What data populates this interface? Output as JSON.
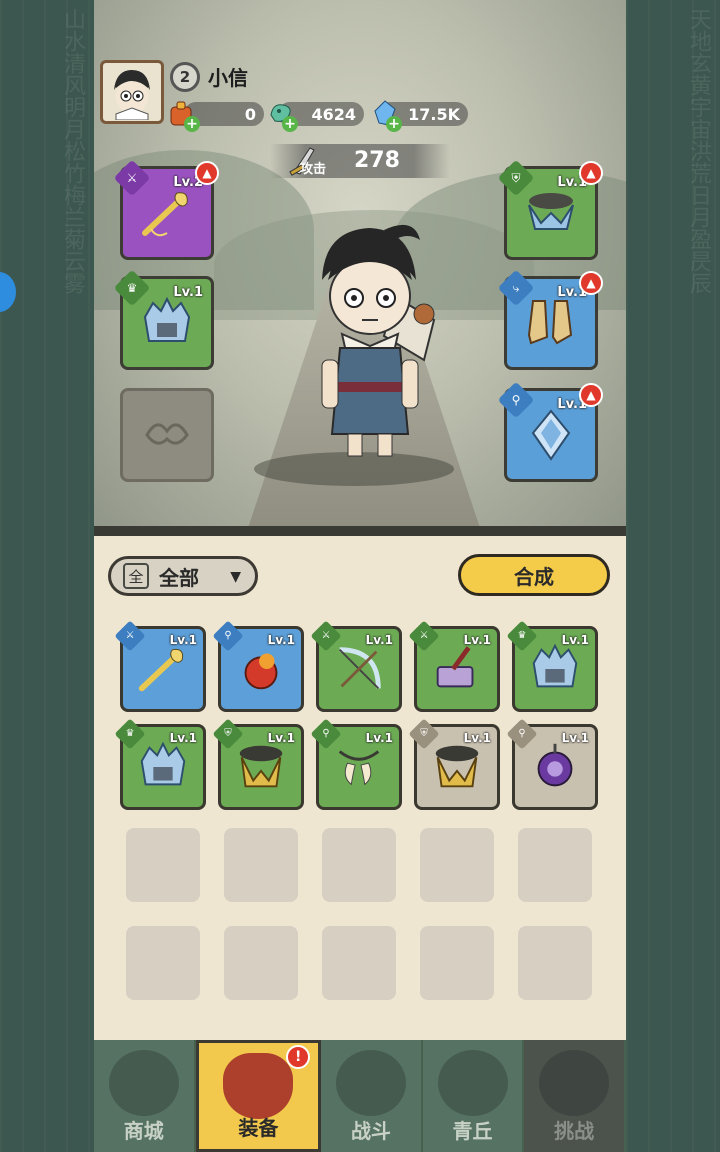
{
  "player": {
    "name": "小信",
    "level": "2"
  },
  "currencies": [
    {
      "icon": "gift-bag-icon",
      "value": "0"
    },
    {
      "icon": "jade-dragon-icon",
      "value": "4624"
    },
    {
      "icon": "crystal-icon",
      "value": "17.5K"
    }
  ],
  "attack": {
    "label": "攻击",
    "value": "278"
  },
  "equipped": {
    "left": [
      {
        "name": "weapon",
        "level": "Lv.2",
        "rarity": "purple",
        "icon": "golden-staff-icon",
        "upgrade": true
      },
      {
        "name": "helmet",
        "level": "Lv.1",
        "rarity": "green",
        "icon": "ice-helmet-icon",
        "upgrade": false
      },
      {
        "name": "accessory",
        "level": "",
        "rarity": "empty",
        "icon": "empty-ornament-icon",
        "upgrade": false
      }
    ],
    "right": [
      {
        "name": "armor",
        "level": "Lv.1",
        "rarity": "green",
        "icon": "fur-armor-icon",
        "upgrade": true
      },
      {
        "name": "boots",
        "level": "Lv.1",
        "rarity": "blue",
        "icon": "boots-icon",
        "upgrade": true
      },
      {
        "name": "amulet",
        "level": "Lv.1",
        "rarity": "blue",
        "icon": "crystal-amulet-icon",
        "upgrade": true
      }
    ]
  },
  "filter": {
    "box_label": "全",
    "label": "全部"
  },
  "merge_label": "合成",
  "inventory": [
    {
      "rarity": "blue",
      "level": "Lv.1",
      "icon": "golden-staff-icon"
    },
    {
      "rarity": "blue",
      "level": "Lv.1",
      "icon": "red-orb-necklace-icon"
    },
    {
      "rarity": "green",
      "level": "Lv.1",
      "icon": "bow-icon"
    },
    {
      "rarity": "green",
      "level": "Lv.1",
      "icon": "hammer-icon"
    },
    {
      "rarity": "green",
      "level": "Lv.1",
      "icon": "ice-helmet-icon"
    },
    {
      "rarity": "green",
      "level": "Lv.1",
      "icon": "ice-helmet-icon"
    },
    {
      "rarity": "green",
      "level": "Lv.1",
      "icon": "gold-armor-icon"
    },
    {
      "rarity": "green",
      "level": "Lv.1",
      "icon": "fang-necklace-icon"
    },
    {
      "rarity": "grey",
      "level": "Lv.1",
      "icon": "gold-armor-icon"
    },
    {
      "rarity": "grey",
      "level": "Lv.1",
      "icon": "purple-orb-icon"
    }
  ],
  "nav": [
    {
      "label": "商城",
      "icon": "shop-icon",
      "state": "normal"
    },
    {
      "label": "装备",
      "icon": "equipment-helmet-icon",
      "state": "active",
      "alert": "!"
    },
    {
      "label": "战斗",
      "icon": "crossed-swords-icon",
      "state": "normal"
    },
    {
      "label": "青丘",
      "icon": "mountain-icon",
      "state": "normal"
    },
    {
      "label": "挑战",
      "icon": "challenge-orb-icon",
      "state": "locked"
    }
  ]
}
